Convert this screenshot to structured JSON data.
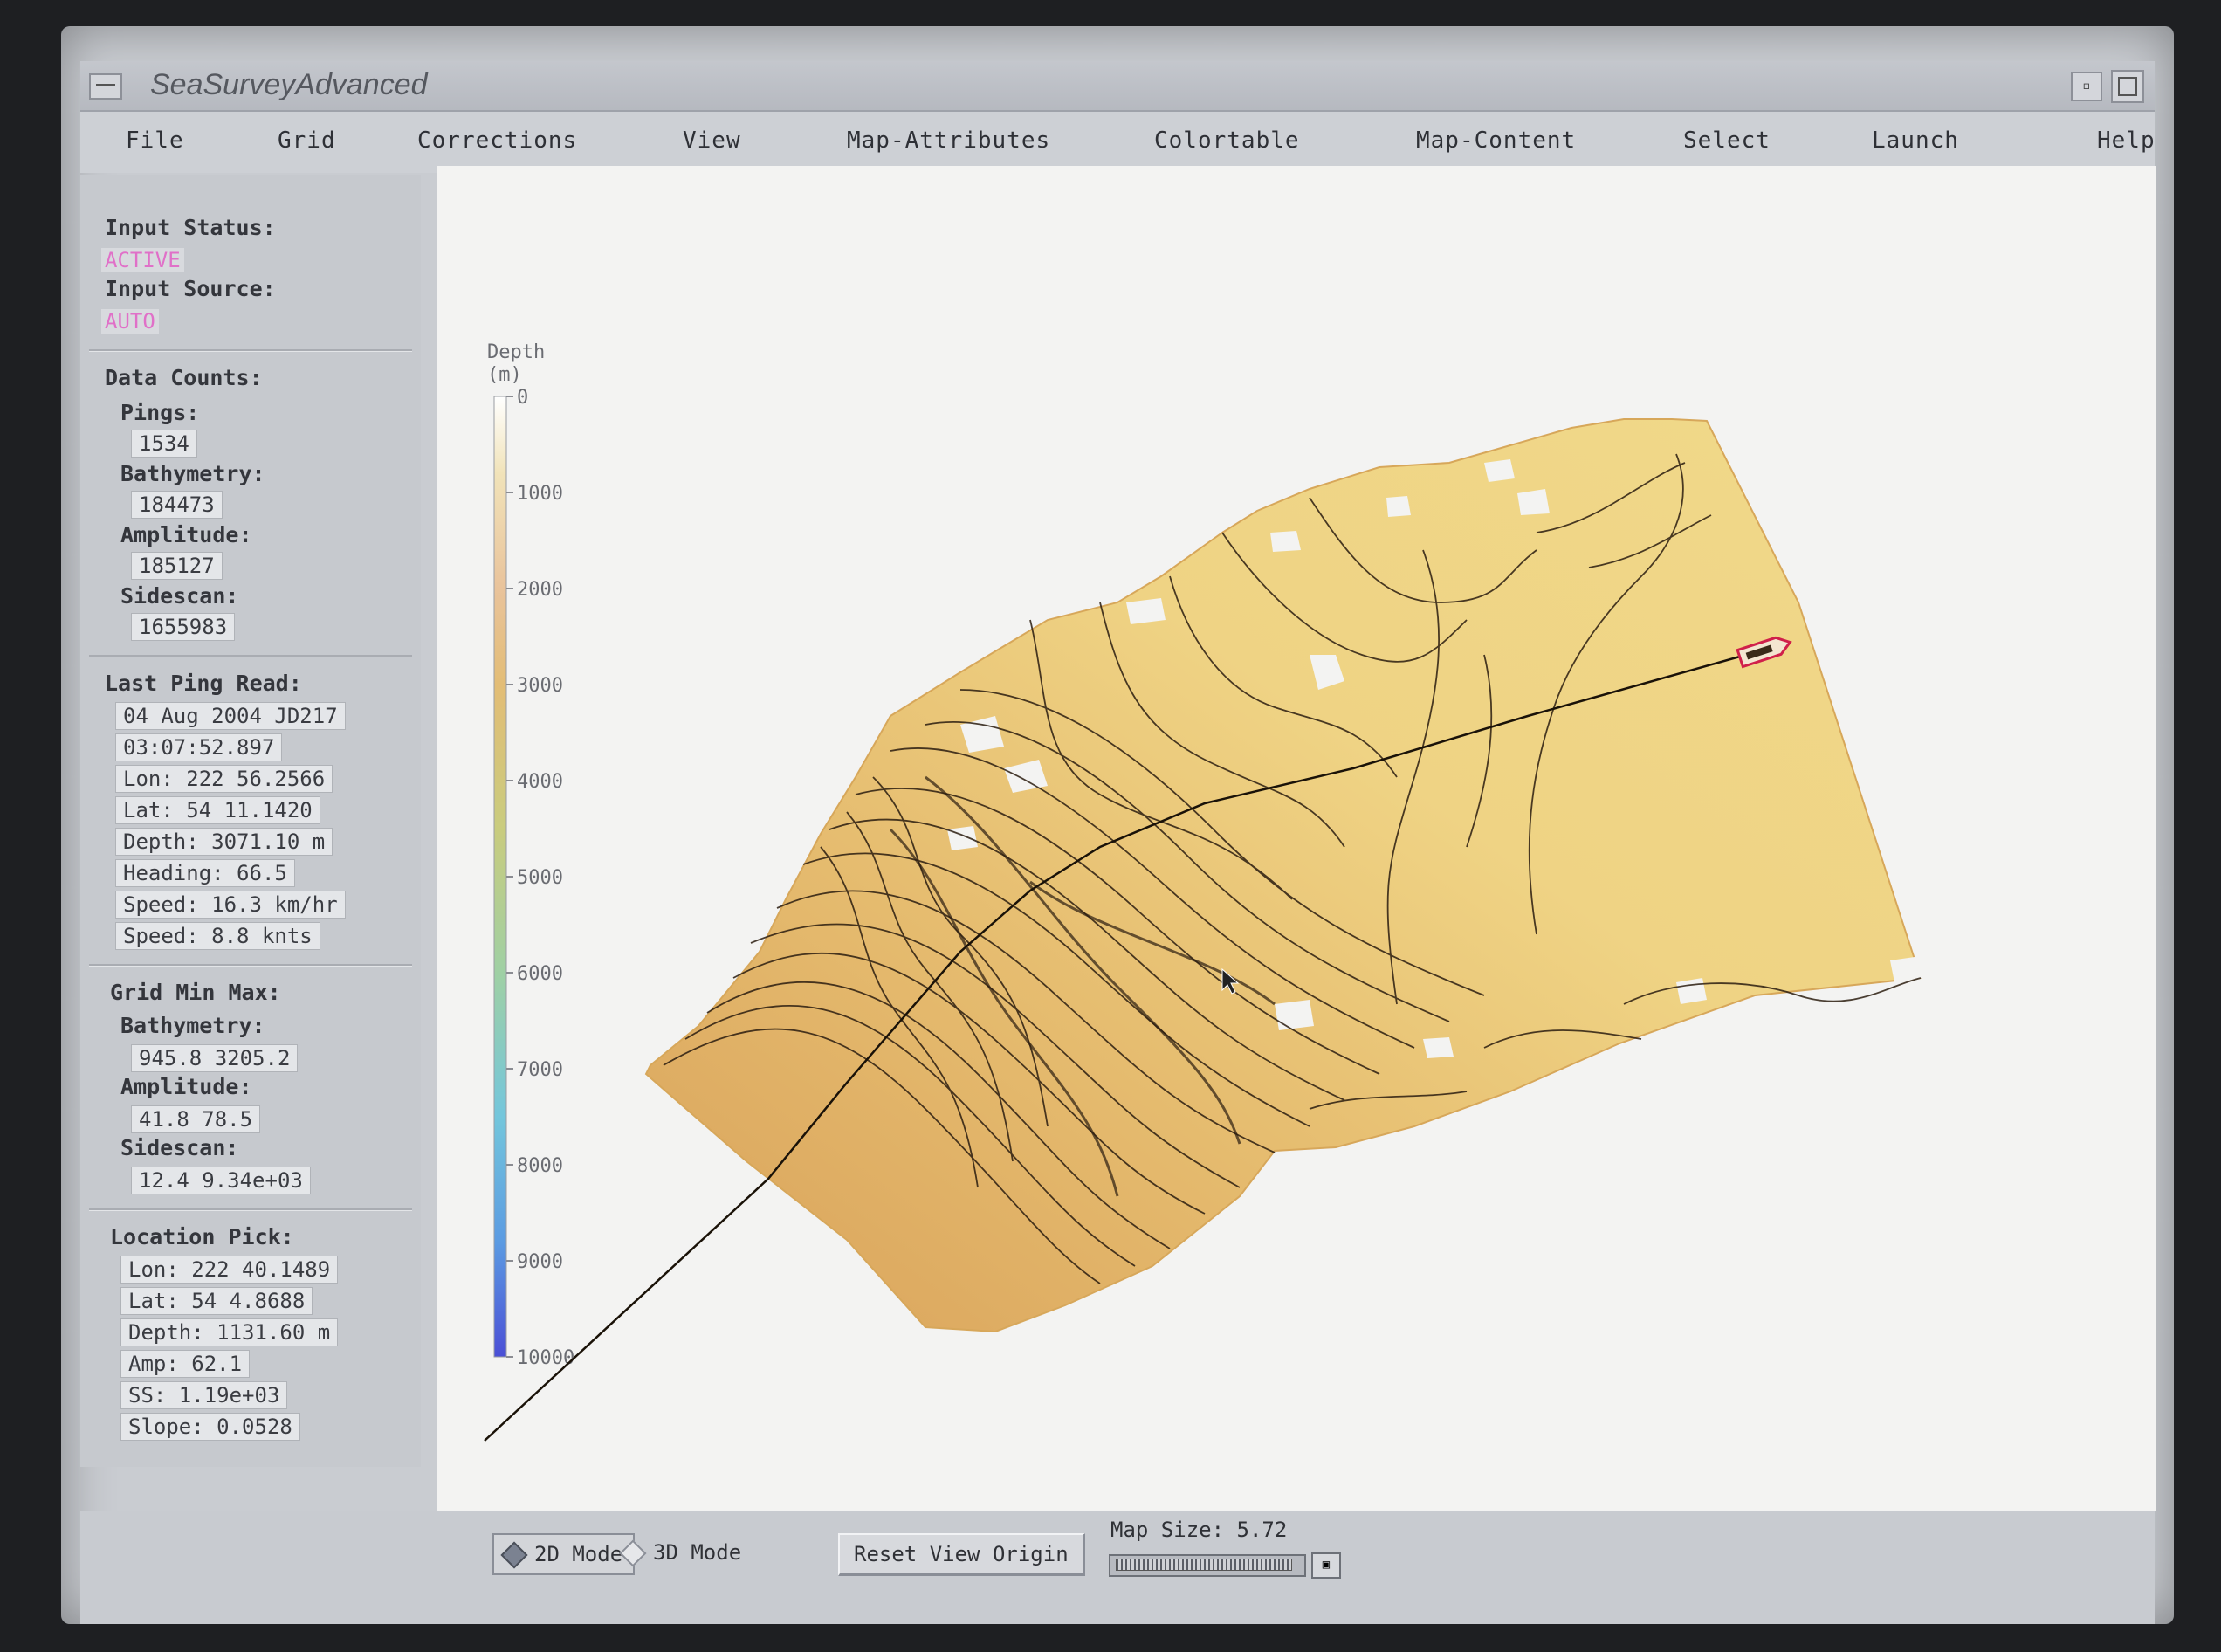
{
  "window": {
    "title": "SeaSurveyAdvanced",
    "controls": {
      "minimize": "▫",
      "maximize": ""
    }
  },
  "menu": [
    "File",
    "Grid",
    "Corrections",
    "View",
    "Map-Attributes",
    "Colortable",
    "Map-Content",
    "Select",
    "Launch",
    "Help"
  ],
  "status": {
    "input_status_label": "Input Status:",
    "input_status": "ACTIVE",
    "input_source_label": "Input Source:",
    "input_source": "AUTO"
  },
  "data_counts": {
    "title": "Data Counts:",
    "pings_label": "Pings:",
    "pings": "1534",
    "bathymetry_label": "Bathymetry:",
    "bathymetry": "184473",
    "amplitude_label": "Amplitude:",
    "amplitude": "185127",
    "sidescan_label": "Sidescan:",
    "sidescan": "1655983"
  },
  "last_ping": {
    "title": "Last Ping Read:",
    "date": "04 Aug 2004 JD217",
    "time": "03:07:52.897",
    "lon": "Lon: 222 56.2566",
    "lat": "Lat:  54 11.1420",
    "depth": "Depth: 3071.10 m",
    "heading": "Heading: 66.5",
    "speed_kmh": "Speed: 16.3 km/hr",
    "speed_knts": "Speed: 8.8 knts"
  },
  "grid_min_max": {
    "title": "Grid Min Max:",
    "bathymetry_label": "Bathymetry:",
    "bathymetry": "945.8 3205.2",
    "amplitude_label": "Amplitude:",
    "amplitude": "41.8 78.5",
    "sidescan_label": "Sidescan:",
    "sidescan": "12.4 9.34e+03"
  },
  "location_pick": {
    "title": "Location Pick:",
    "lon": "Lon: 222 40.1489",
    "lat": "Lat:  54  4.8688",
    "depth": "Depth: 1131.60 m",
    "amp": "Amp: 62.1",
    "ss": "SS: 1.19e+03",
    "slope": "Slope: 0.0528"
  },
  "colorbar": {
    "title_line1": "Depth",
    "title_line2": "(m)",
    "ticks": [
      "0",
      "1000",
      "2000",
      "3000",
      "4000",
      "5000",
      "6000",
      "7000",
      "8000",
      "9000",
      "10000"
    ]
  },
  "colors": {
    "map_low": "#d9a25a",
    "map_high": "#f0d98a",
    "contour": "#2b1d10",
    "track": "#1a1208",
    "vessel": "#d0204a",
    "status_pink": "#e070c8"
  },
  "bottom": {
    "mode_2d": "2D Mode",
    "mode_3d": "3D Mode",
    "active_mode": "2D",
    "reset": "Reset View Origin",
    "mapsize_label": "Map Size:",
    "mapsize_value": "5.72"
  }
}
